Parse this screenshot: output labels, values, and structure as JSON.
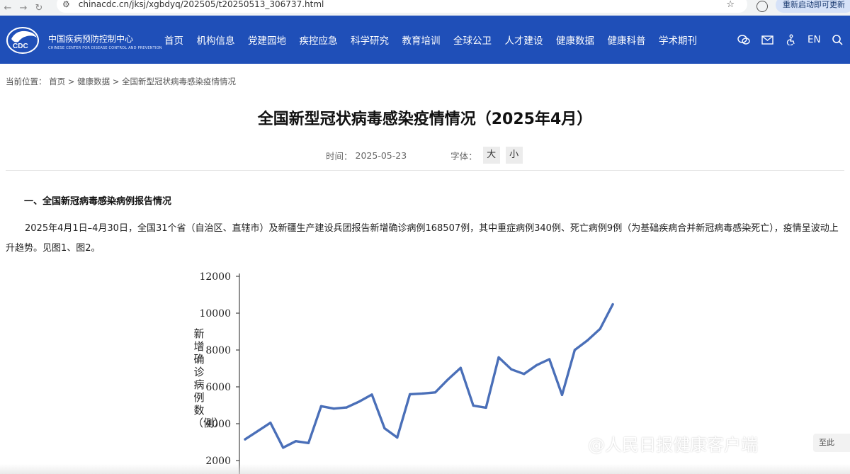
{
  "browser": {
    "url": "chinacdc.cn/jksj/xgbdyq/202505/t20250513_306737.html",
    "restart_label": "重新启动即可更新"
  },
  "header": {
    "logo_cn": "中国疾病预防控制中心",
    "logo_en": "CHINESE CENTER FOR DISEASE CONTROL AND PREVENTION",
    "logo_badge": "CDC",
    "nav": [
      "首页",
      "机构信息",
      "党建园地",
      "疾控应急",
      "科学研究",
      "教育培训",
      "全球公卫",
      "人才建设",
      "健康数据",
      "健康科普",
      "学术期刊"
    ],
    "lang": "EN",
    "brand_color": "#1f4fb8"
  },
  "breadcrumb": "当前位置： 首页 > 健康数据 > 全国新型冠状病毒感染疫情情况",
  "article": {
    "title": "全国新型冠状病毒感染疫情情况（2025年4月）",
    "date_label": "时间：",
    "date": "2025-05-23",
    "font_label": "字体：",
    "font_large": "大",
    "font_small": "小",
    "section_heading": "一、全国新冠病毒感染病例报告情况",
    "paragraph": "2025年4月1日–4月30日，全国31个省（自治区、直辖市）及新疆生产建设兵团报告新增确诊病例168507例，其中重症病例340例、死亡病例9例（为基础疾病合并新冠病毒感染死亡），疫情呈波动上升趋势。见图1、图2。"
  },
  "chart_data": {
    "type": "line",
    "ylabel": "新增确诊病例数（例）",
    "ylim": [
      2000,
      12000
    ],
    "y_ticks": [
      "12000",
      "10000",
      "8000",
      "6000",
      "4000",
      "2000"
    ],
    "x": [
      1,
      2,
      3,
      4,
      5,
      6,
      7,
      8,
      9,
      10,
      11,
      12,
      13,
      14,
      15,
      16,
      17,
      18,
      19,
      20,
      21,
      22,
      23,
      24,
      25,
      26,
      27,
      28,
      29,
      30
    ],
    "series": [
      {
        "values": [
          3150,
          3600,
          4050,
          2700,
          3050,
          2950,
          4950,
          4820,
          4880,
          5200,
          5580,
          3750,
          3250,
          5600,
          5640,
          5700,
          6400,
          7030,
          4980,
          4870,
          7600,
          6950,
          6700,
          7180,
          7500,
          5560,
          8000,
          8520,
          9150,
          10480
        ]
      }
    ],
    "line_color": "#4a6fb8",
    "grid": false
  },
  "watermark": "@人民日报健康客户端",
  "corner_tag": "至此"
}
